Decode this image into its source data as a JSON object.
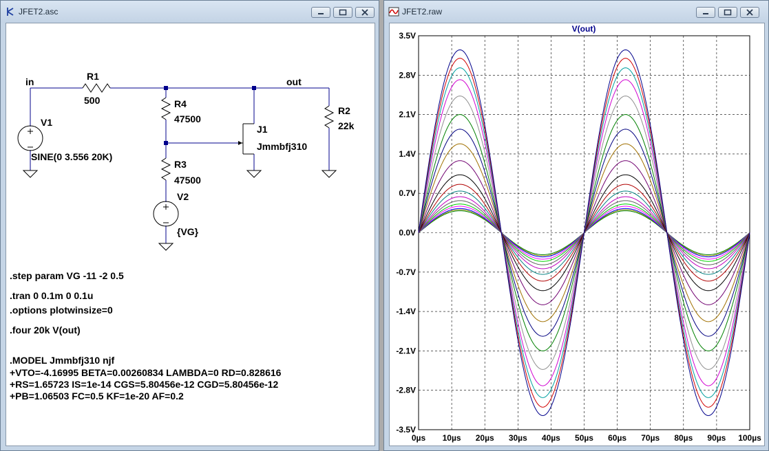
{
  "schematic_window": {
    "title": "JFET2.asc",
    "labels": {
      "in": "in",
      "out": "out",
      "r1": "R1",
      "r1_val": "500",
      "r2": "R2",
      "r2_val": "22k",
      "r3": "R3",
      "r3_val": "47500",
      "r4": "R4",
      "r4_val": "47500",
      "v1": "V1",
      "v1_val": "SINE(0 3.556 20K)",
      "v2": "V2",
      "v2_val": "{VG}",
      "j1": "J1",
      "j1_val": "Jmmbfj310"
    },
    "directives": [
      ".step param VG -11 -2 0.5",
      ".tran 0 0.1m 0 0.1u",
      ".options plotwinsize=0",
      ".four 20k V(out)",
      ".MODEL Jmmbfj310 njf",
      "+VTO=-4.16995 BETA=0.00260834 LAMBDA=0 RD=0.828616",
      "+RS=1.65723 IS=1e-14 CGS=5.80456e-12 CGD=5.80456e-12",
      "+PB=1.06503 FC=0.5 KF=1e-20 AF=0.2"
    ]
  },
  "waveform_window": {
    "title": "JFET2.raw"
  },
  "chart_data": {
    "type": "line",
    "title": "V(out)",
    "xlabel": "",
    "ylabel": "",
    "x_ticks": [
      "0µs",
      "10µs",
      "20µs",
      "30µs",
      "40µs",
      "50µs",
      "60µs",
      "70µs",
      "80µs",
      "90µs",
      "100µs"
    ],
    "y_ticks": [
      "3.5V",
      "2.8V",
      "2.1V",
      "1.4V",
      "0.7V",
      "0.0V",
      "-0.7V",
      "-1.4V",
      "-2.1V",
      "-2.8V",
      "-3.5V"
    ],
    "xlim": [
      0,
      100
    ],
    "x_unit": "µs",
    "ylim": [
      -3.5,
      3.5
    ],
    "grid": true,
    "frequency_khz": 20,
    "series_amplitudes_pos": [
      3.25,
      3.1,
      2.93,
      2.72,
      2.43,
      2.1,
      1.84,
      1.58,
      1.28,
      1.03,
      0.86,
      0.74,
      0.64,
      0.57,
      0.51,
      0.47,
      0.43,
      0.41,
      0.39
    ],
    "series_amplitudes_neg": [
      3.25,
      3.1,
      2.93,
      2.72,
      2.43,
      2.1,
      1.84,
      1.58,
      1.28,
      1.03,
      0.86,
      0.74,
      0.64,
      0.57,
      0.51,
      0.47,
      0.43,
      0.41,
      0.39
    ],
    "series_colors": [
      "#00008b",
      "#d10000",
      "#00a0a0",
      "#d000d0",
      "#909090",
      "#008000",
      "#000080",
      "#a07000",
      "#700070",
      "#000000",
      "#b00000",
      "#008080",
      "#c000c0",
      "#606060",
      "#00d000",
      "#ff00ff",
      "#0000ff",
      "#909000",
      "#008000"
    ]
  }
}
